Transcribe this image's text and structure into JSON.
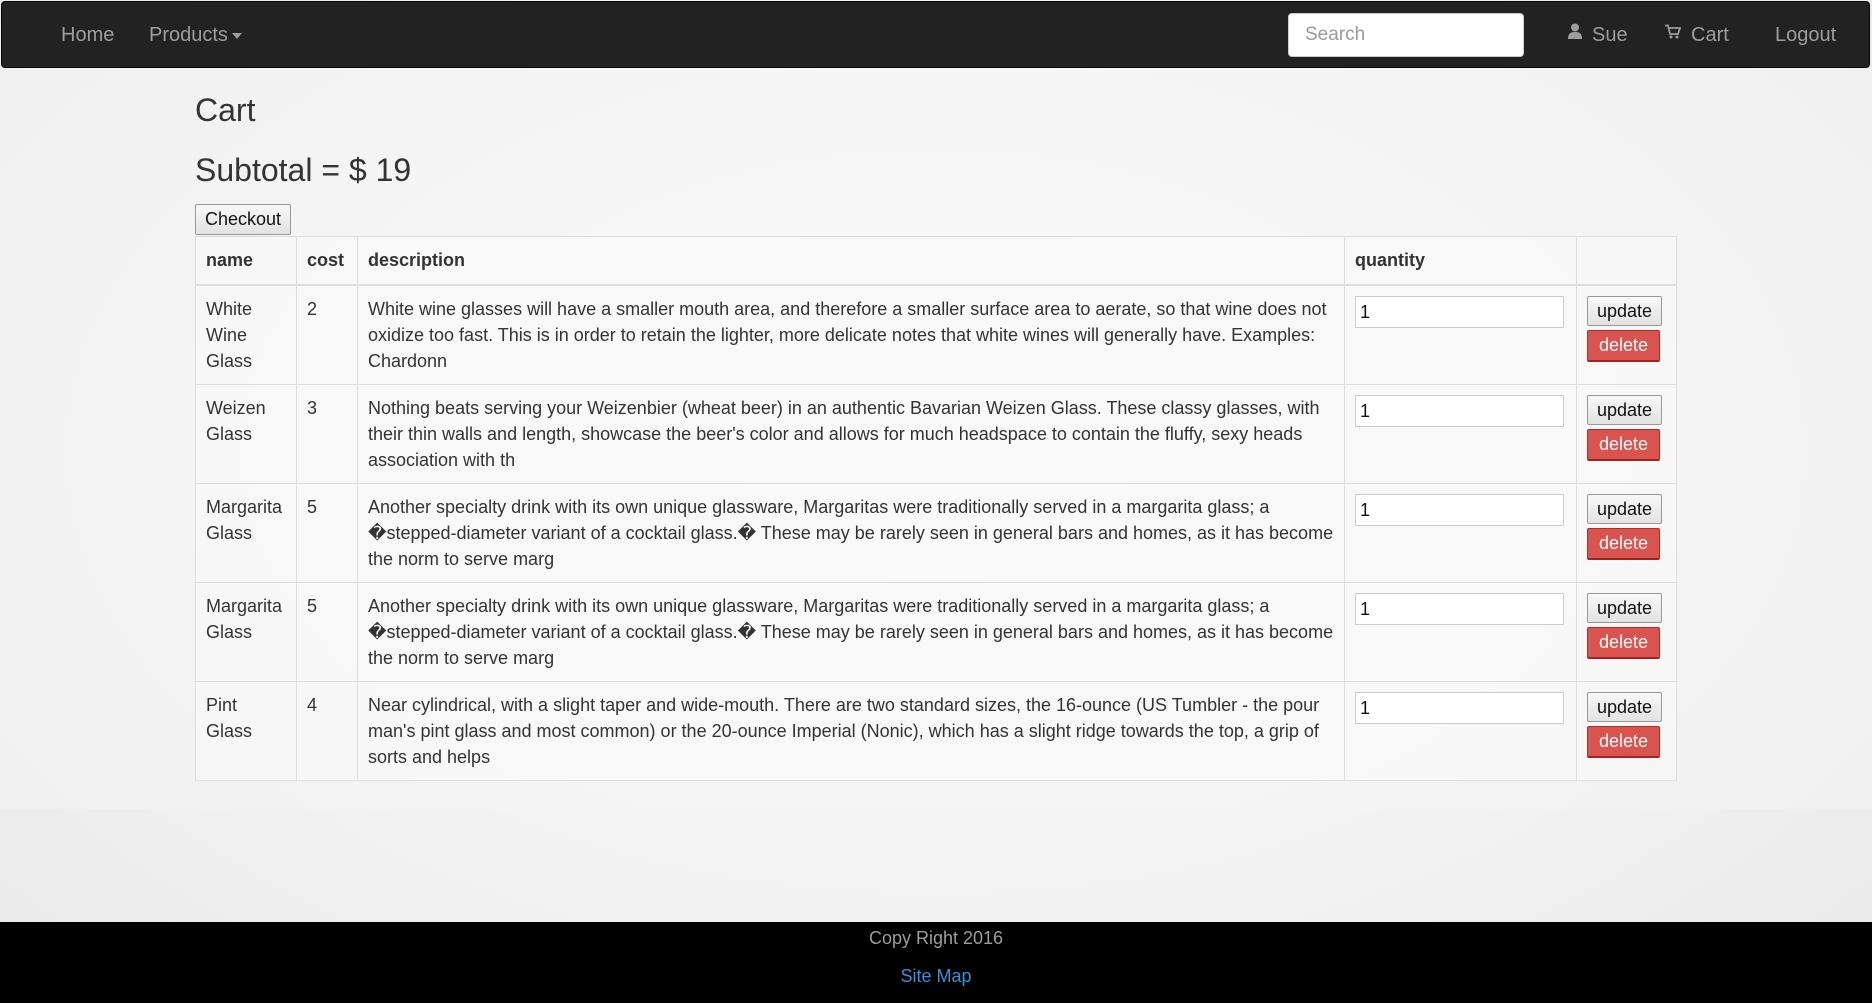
{
  "navbar": {
    "home": "Home",
    "products": "Products",
    "search_placeholder": "Search",
    "user": "Sue",
    "cart": "Cart",
    "logout": "Logout"
  },
  "page": {
    "title": "Cart",
    "subtotal": "Subtotal = $ 19",
    "checkout": "Checkout"
  },
  "table": {
    "headers": {
      "name": "name",
      "cost": "cost",
      "description": "description",
      "quantity": "quantity",
      "actions": ""
    },
    "update_label": "update",
    "delete_label": "delete",
    "rows": [
      {
        "name": "White Wine Glass",
        "cost": "2",
        "description": "White wine glasses will have a smaller mouth area, and therefore a smaller surface area to aerate, so that wine does not oxidize too fast. This is in order to retain the lighter, more delicate notes that white wines will generally have. Examples: Chardonn",
        "quantity": "1"
      },
      {
        "name": "Weizen Glass",
        "cost": "3",
        "description": "Nothing beats serving your Weizenbier (wheat beer) in an authentic Bavarian Weizen Glass. These classy glasses, with their thin walls and length, showcase the beer's color and allows for much headspace to contain the fluffy, sexy heads association with th",
        "quantity": "1"
      },
      {
        "name": "Margarita Glass",
        "cost": "5",
        "description": "Another specialty drink with its own unique glassware, Margaritas were traditionally served in a margarita glass; a �stepped-diameter variant of a cocktail glass.� These may be rarely seen in general bars and homes, as it has become the norm to serve marg",
        "quantity": "1"
      },
      {
        "name": "Margarita Glass",
        "cost": "5",
        "description": "Another specialty drink with its own unique glassware, Margaritas were traditionally served in a margarita glass; a �stepped-diameter variant of a cocktail glass.� These may be rarely seen in general bars and homes, as it has become the norm to serve marg",
        "quantity": "1"
      },
      {
        "name": "Pint Glass",
        "cost": "4",
        "description": "Near cylindrical, with a slight taper and wide-mouth. There are two standard sizes, the 16-ounce (US Tumbler - the pour man's pint glass and most common) or the 20-ounce Imperial (Nonic), which has a slight ridge towards the top, a grip of sorts and helps",
        "quantity": "1"
      }
    ]
  },
  "footer": {
    "copyright": "Copy Right 2016",
    "sitemap": "Site Map"
  },
  "icons": {
    "user": "user-icon",
    "cart": "cart-icon",
    "products_caret": "chevron-down-icon"
  },
  "colors": {
    "navbar_bg": "#222222",
    "nav_text": "#9d9d9d",
    "delete_bg": "#d9534f",
    "footer_bg": "#000000",
    "link": "#3a8fd6"
  }
}
